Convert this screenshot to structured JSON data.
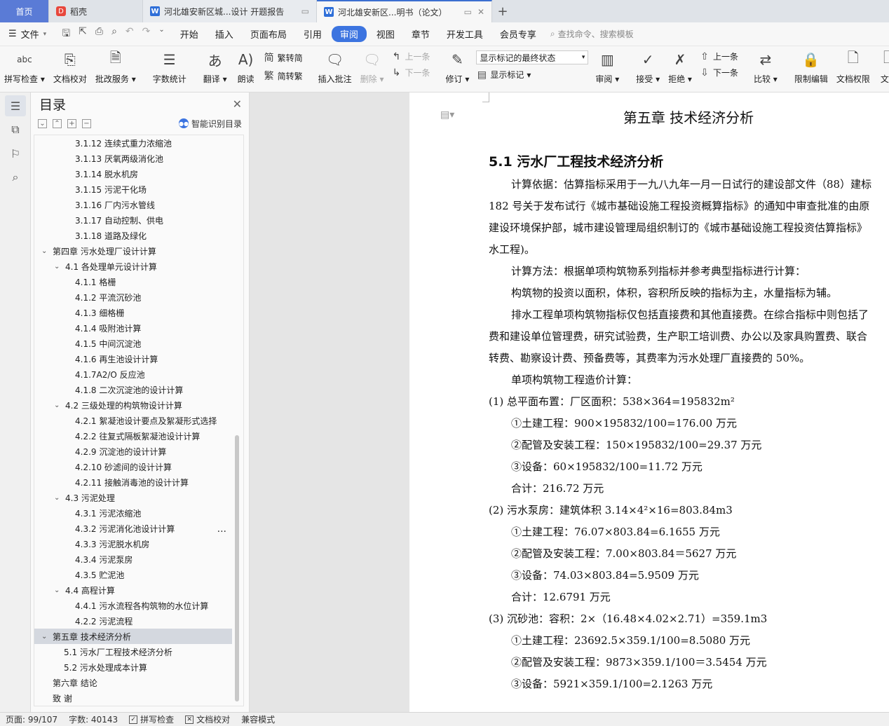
{
  "tabs": {
    "home": "首页",
    "daoke": "稻壳",
    "doc1": "河北雄安新区城...设计 开题报告",
    "doc2": "河北雄安新区...明书（论文）",
    "add": "+"
  },
  "menu": {
    "file": "文件",
    "items": [
      "开始",
      "插入",
      "页面布局",
      "引用",
      "审阅",
      "视图",
      "章节",
      "开发工具",
      "会员专享"
    ],
    "active": "审阅",
    "search": "查找命令、搜索模板"
  },
  "ribbon": {
    "spell": "拼写检查",
    "proof": "文档校对",
    "annot_service": "批改服务",
    "wordcount": "字数统计",
    "translate": "翻译",
    "read": "朗读",
    "trad": "繁转简",
    "simp": "简转繁",
    "insert_comment": "插入批注",
    "delete": "删除",
    "prev": "上一条",
    "next": "下一条",
    "revise": "修订",
    "markup_select": "显示标记的最终状态",
    "show_markup": "显示标记",
    "review": "审阅",
    "accept": "接受",
    "reject": "拒绝",
    "prev2": "上一条",
    "next2": "下一条",
    "compare": "比较",
    "restrict": "限制编辑",
    "permission": "文档权限",
    "doc_cut": "文档"
  },
  "toc": {
    "title": "目录",
    "smart": "智能识别目录",
    "items": [
      {
        "text": "3.1.12 连续式重力浓缩池",
        "level": "l3"
      },
      {
        "text": "3.1.13 厌氧两级消化池",
        "level": "l3"
      },
      {
        "text": "3.1.14 脱水机房",
        "level": "l3"
      },
      {
        "text": "3.1.15 污泥干化场",
        "level": "l3"
      },
      {
        "text": "3.1.16  厂内污水管线",
        "level": "l3"
      },
      {
        "text": "3.1.17  自动控制、供电",
        "level": "l3"
      },
      {
        "text": "3.1.18  道路及绿化",
        "level": "l3"
      },
      {
        "text": "第四章  污水处理厂设计计算",
        "level": "l1",
        "caret": true
      },
      {
        "text": "4.1 各处理单元设计计算",
        "level": "l2",
        "caret": true
      },
      {
        "text": "4.1.1 格栅",
        "level": "l3"
      },
      {
        "text": "4.1.2 平流沉砂池",
        "level": "l3"
      },
      {
        "text": "4.1.3 细格栅",
        "level": "l3"
      },
      {
        "text": "4.1.4 吸附池计算",
        "level": "l3"
      },
      {
        "text": "4.1.5 中间沉淀池",
        "level": "l3"
      },
      {
        "text": "4.1.6 再生池设计计算",
        "level": "l3"
      },
      {
        "text": "4.1.7A2/O 反应池",
        "level": "l3"
      },
      {
        "text": "4.1.8 二次沉淀池的设计计算",
        "level": "l3"
      },
      {
        "text": "4.2 三级处理的构筑物设计计算",
        "level": "l2",
        "caret": true
      },
      {
        "text": "4.2.1 絮凝池设计要点及絮凝形式选择",
        "level": "l3"
      },
      {
        "text": "4.2.2 往复式隔板絮凝池设计计算",
        "level": "l3"
      },
      {
        "text": "4.2.9  沉淀池的设计计算",
        "level": "l3"
      },
      {
        "text": "4.2.10 砂滤间的设计计算",
        "level": "l3"
      },
      {
        "text": "4.2.11 接触消毒池的设计计算",
        "level": "l3"
      },
      {
        "text": "4.3 污泥处理",
        "level": "l2",
        "caret": true
      },
      {
        "text": "4.3.1 污泥浓缩池",
        "level": "l3"
      },
      {
        "text": "4.3.2 污泥消化池设计计算",
        "level": "l3"
      },
      {
        "text": "4.3.3 污泥脱水机房",
        "level": "l3"
      },
      {
        "text": "4.3.4 污泥泵房",
        "level": "l3"
      },
      {
        "text": "4.3.5 贮泥池",
        "level": "l3"
      },
      {
        "text": "4.4 高程计算",
        "level": "l2",
        "caret": true
      },
      {
        "text": "4.4.1 污水流程各构筑物的水位计算",
        "level": "l3"
      },
      {
        "text": "4.2.2 污泥流程",
        "level": "l3"
      },
      {
        "text": "第五章  技术经济分析",
        "level": "l1",
        "caret": true,
        "selected": true
      },
      {
        "text": "5.1 污水厂工程技术经济分析",
        "level": "l2n"
      },
      {
        "text": "5.2 污水处理成本计算",
        "level": "l2n"
      },
      {
        "text": "第六章  结论",
        "level": "l1n"
      },
      {
        "text": "致    谢",
        "level": "l1n"
      }
    ],
    "more": "..."
  },
  "doc": {
    "chapter": "第五章  技术经济分析",
    "section": "5.1 污水厂工程技术经济分析",
    "lines": [
      {
        "t": "计算依据：估算指标采用于一九八九年一月一日试行的建设部文件（88）建标",
        "ind": true
      },
      {
        "t": "182 号关于发布试行《城市基础设施工程投资概算指标》的通知中审查批准的由原",
        "ind": false
      },
      {
        "t": "建设环境保护部，城市建设管理局组织制订的《城市基础设施工程投资估算指标》",
        "ind": false
      },
      {
        "t": "水工程)。",
        "ind": false
      },
      {
        "t": "计算方法：根据单项构筑物系列指标并参考典型指标进行计算：",
        "ind": true
      },
      {
        "t": "构筑物的投资以面积，体积，容积所反映的指标为主，水量指标为辅。",
        "ind": true
      },
      {
        "t": "排水工程单项构筑物指标仅包括直接费和其他直接费。在综合指标中则包括了",
        "ind": true
      },
      {
        "t": "费和建设单位管理费，研究试验费，生产职工培训费、办公以及家具购置费、联合",
        "ind": false
      },
      {
        "t": "转费、勘察设计费、预备费等，其费率为污水处理厂直接费的 50%。",
        "ind": false
      },
      {
        "t": "单项构筑物工程造价计算：",
        "ind": true
      },
      {
        "t": "(1) 总平面布置：厂区面积：538×364=195832m²",
        "ind": false
      },
      {
        "t": "①土建工程：900×195832/100=176.00 万元",
        "ind": true
      },
      {
        "t": "②配管及安装工程：150×195832/100=29.37 万元",
        "ind": true
      },
      {
        "t": "③设备：60×195832/100=11.72 万元",
        "ind": true
      },
      {
        "t": "合计：216.72 万元",
        "ind": true
      },
      {
        "t": "(2) 污水泵房：建筑体积 3.14×4²×16=803.84m3",
        "ind": false
      },
      {
        "t": "①土建工程：76.07×803.84=6.1655 万元",
        "ind": true
      },
      {
        "t": "②配管及安装工程：7.00×803.84＝5627 万元",
        "ind": true
      },
      {
        "t": "③设备：74.03×803.84=5.9509 万元",
        "ind": true
      },
      {
        "t": "合计：12.6791 万元",
        "ind": true
      },
      {
        "t": "(3) 沉砂池：容积：2×（16.48×4.02×2.71）=359.1m3",
        "ind": false
      },
      {
        "t": "①土建工程：23692.5×359.1/100=8.5080 万元",
        "ind": true
      },
      {
        "t": "②配管及安装工程：9873×359.1/100＝3.5454 万元",
        "ind": true
      },
      {
        "t": "③设备：5921×359.1/100=2.1263 万元",
        "ind": true
      }
    ]
  },
  "status": {
    "page": "页面: 99/107",
    "words": "字数: 40143",
    "spell": "拼写检查",
    "proof": "文档校对",
    "compat": "兼容模式"
  }
}
